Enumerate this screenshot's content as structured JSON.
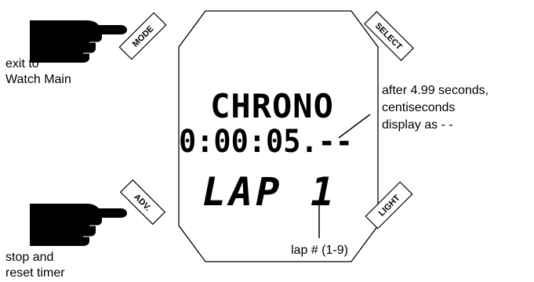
{
  "buttons": {
    "mode": "MODE",
    "select": "SELECT",
    "adv": "ADV.",
    "light": "LIGHT"
  },
  "display": {
    "line1": "CHRONO",
    "line2": "0:00:05.--",
    "line3_label": "LAP",
    "line3_value": "1"
  },
  "notes": {
    "mode_line1": "exit to",
    "mode_line2": "Watch Main",
    "adv_line1": "stop and",
    "adv_line2": "reset timer",
    "cs_line1": "after 4.99 seconds,",
    "cs_line2": "centiseconds",
    "cs_line3": "display as - -",
    "lap_note": "lap # (1-9)"
  }
}
